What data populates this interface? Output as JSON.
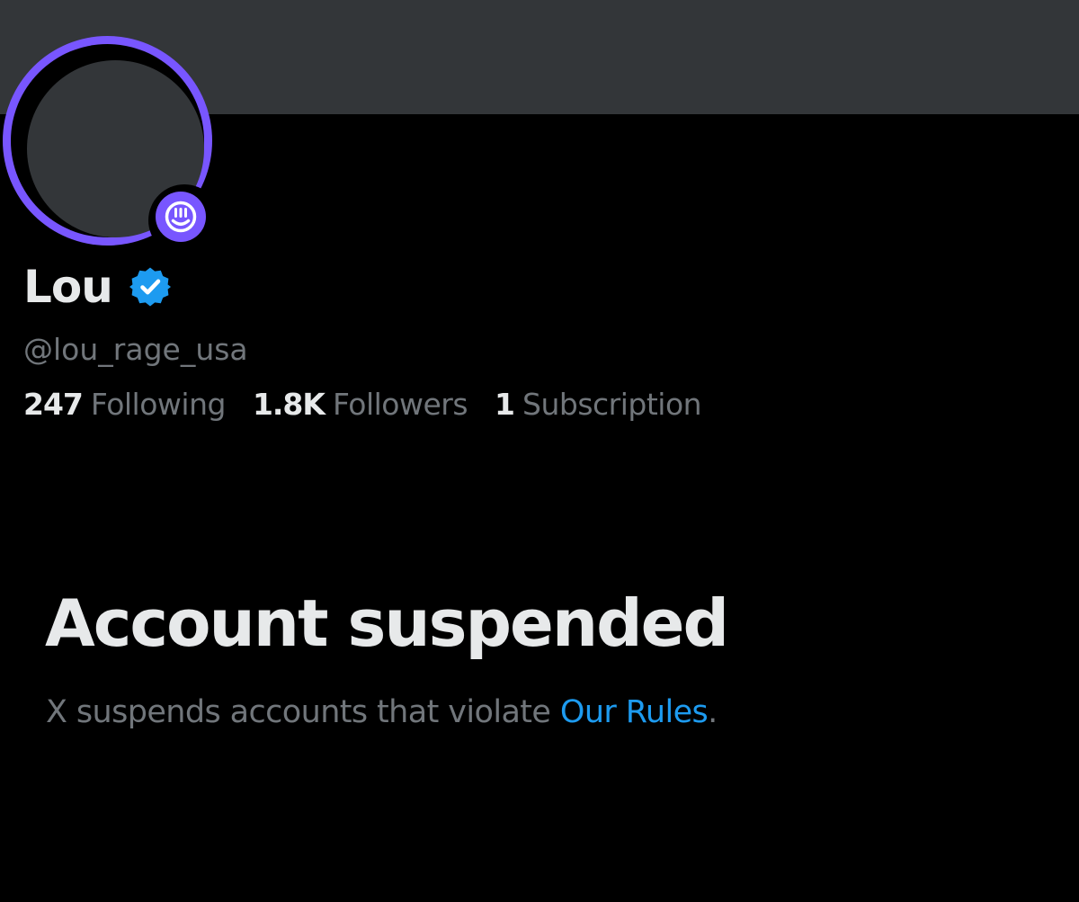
{
  "colors": {
    "background": "#000000",
    "banner": "#333639",
    "avatar_ring": "#7856ff",
    "primary_text": "#e7e9ea",
    "secondary_text": "#71767b",
    "link": "#1d9bf0",
    "verified_badge": "#1d9bf0"
  },
  "profile": {
    "display_name": "Lou",
    "handle": "@lou_rage_usa",
    "verified_icon": "verified-badge-icon",
    "avatar_badge_icon": "smiley-face-icon",
    "stats": {
      "following_count": "247",
      "following_label": "Following",
      "followers_count": "1.8K",
      "followers_label": "Followers",
      "subscription_count": "1",
      "subscription_label": "Subscription"
    }
  },
  "suspension": {
    "title": "Account suspended",
    "message_prefix": "X suspends accounts that violate ",
    "link_label": "Our Rules",
    "message_suffix": "."
  }
}
